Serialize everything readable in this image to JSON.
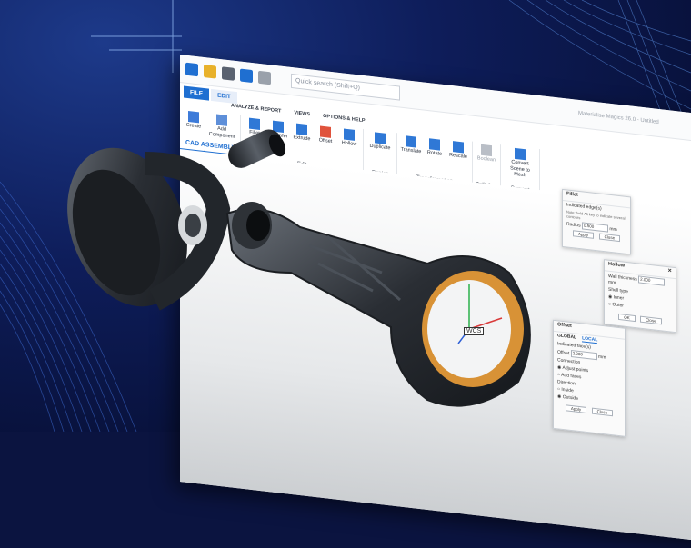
{
  "app": {
    "window_title": "Materialise Magics 26.0 - Untitled",
    "quick_search_placeholder": "Quick search (Shift+Q)"
  },
  "menu": {
    "file": "FILE",
    "edit": "EDIT",
    "analyze_report": "ANALYZE & REPORT",
    "views": "VIEWS",
    "options_help": "OPTIONS & HELP"
  },
  "ribbon": {
    "insert_group": {
      "label": "Insert",
      "buttons": [
        "Create",
        "Add Component"
      ]
    },
    "edit_group": {
      "label": "Edit",
      "buttons": [
        "Fillet",
        "Chamfer",
        "Extrude",
        "Offset",
        "Hollow"
      ]
    },
    "copies_group": {
      "label": "Copies",
      "buttons": [
        "Duplicate"
      ]
    },
    "transformation_group": {
      "label": "Transformation",
      "buttons": [
        "Translate",
        "Rotate",
        "Rescale"
      ]
    },
    "split_group": {
      "label": "Split & ...",
      "buttons": [
        "Boolean"
      ]
    },
    "convert_group": {
      "label": "Convert",
      "buttons": [
        "Convert Scene to Mesh"
      ]
    }
  },
  "document_tab": "CAD ASSEMBLY",
  "dialogs": {
    "fillet": {
      "title": "Fillet",
      "indicated_edges": "Indicated edge(s)",
      "note": "Note: hold Alt key to indicate several contours",
      "radius_label": "Radius",
      "radius_value": "0.500",
      "unit": "mm",
      "apply": "Apply",
      "close": "Close"
    },
    "hollow": {
      "title": "Hollow",
      "wall_thickness_label": "Wall thickness",
      "wall_thickness_value": "2.000",
      "unit": "mm",
      "shell_type_label": "Shell type",
      "inner": "Inner",
      "outer": "Outer",
      "ok": "OK",
      "close": "Close"
    },
    "offset": {
      "title": "Offset",
      "tab_global": "GLOBAL",
      "tab_local": "LOCAL",
      "indicated_faces": "Indicated face(s)",
      "offset_label": "Offset",
      "offset_value": "2.000",
      "unit": "mm",
      "connection_label": "Connection",
      "adjust_points": "Adjust points",
      "add_faces": "Add faces",
      "direction_label": "Direction",
      "inside": "Inside",
      "outside": "Outside",
      "apply": "Apply",
      "close": "Close"
    }
  },
  "viewport": {
    "wcs_label": "WCS"
  },
  "colors": {
    "accent": "#1f6fd1",
    "background_navy": "#0b1440",
    "bearing_orange": "#d89236"
  }
}
